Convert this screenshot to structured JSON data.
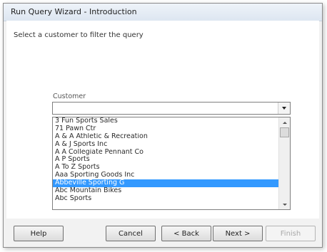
{
  "window": {
    "title": "Run Query Wizard - Introduction"
  },
  "content": {
    "instruction": "Select a customer to filter the query",
    "customer_label": "Customer",
    "customer_value": ""
  },
  "list": {
    "items": [
      "3 Fun Sports Sales",
      "71 Pawn Ctr",
      "A & A Athletic & Recreation",
      "A & J Sports Inc",
      "A A Collegiate Pennant Co",
      "A P Sports",
      "A To Z Sports",
      "Aaa Sporting Goods Inc",
      "Abbeville Sporting G",
      "Abc Mountain Bikes",
      "Abc Sports"
    ],
    "selected_index": 8
  },
  "buttons": {
    "help": "Help",
    "cancel": "Cancel",
    "back": "< Back",
    "next": "Next >",
    "finish": "Finish"
  }
}
